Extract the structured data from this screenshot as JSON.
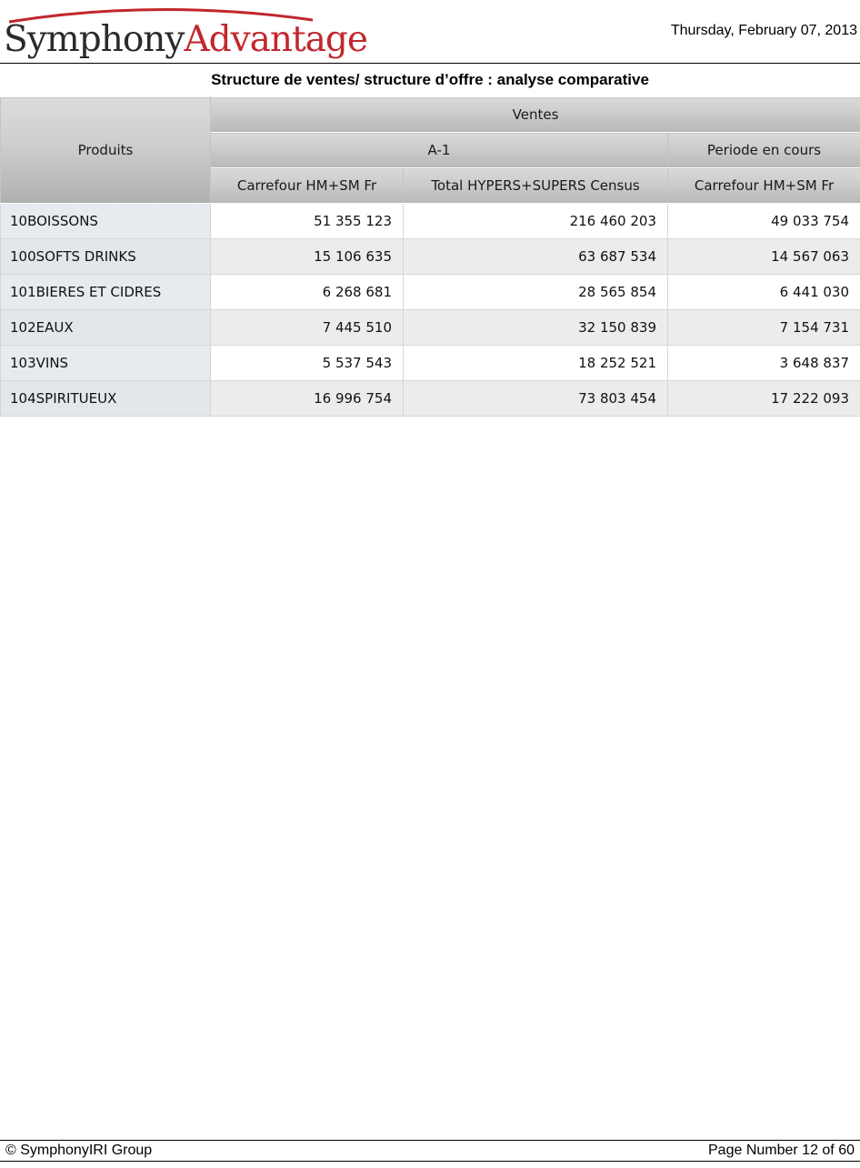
{
  "header": {
    "logo_text_part1": "Symphony",
    "logo_text_part2": "Advantage",
    "date": "Thursday, February 07, 2013"
  },
  "title": "Structure de ventes/ structure d’offre : analyse comparative",
  "table": {
    "row_header": "Produits",
    "measure_header": "Ventes",
    "period_headers": [
      "A-1",
      "Periode en cours"
    ],
    "market_headers": [
      "Carrefour HM+SM Fr",
      "Total HYPERS+SUPERS Census",
      "Carrefour HM+SM Fr"
    ],
    "rows": [
      {
        "label": "10BOISSONS",
        "values": [
          "51 355 123",
          "216 460 203",
          "49 033 754"
        ]
      },
      {
        "label": "100SOFTS DRINKS",
        "values": [
          "15 106 635",
          "63 687 534",
          "14 567 063"
        ]
      },
      {
        "label": "101BIERES ET CIDRES",
        "values": [
          "6 268 681",
          "28 565 854",
          "6 441 030"
        ]
      },
      {
        "label": "102EAUX",
        "values": [
          "7 445 510",
          "32 150 839",
          "7 154 731"
        ]
      },
      {
        "label": "103VINS",
        "values": [
          "5 537 543",
          "18 252 521",
          "3 648 837"
        ]
      },
      {
        "label": "104SPIRITUEUX",
        "values": [
          "16 996 754",
          "73 803 454",
          "17 222 093"
        ]
      }
    ]
  },
  "footer": {
    "copyright": "© SymphonyIRI Group",
    "page_number": "Page Number 12 of 60"
  },
  "colors": {
    "logo_accent": "#c1272d",
    "logo_dark": "#2b2b2b",
    "row_label_bg": "#e7ebf0",
    "header_gradient_top": "#d9d9d9",
    "header_gradient_bottom": "#b8b8b8"
  }
}
